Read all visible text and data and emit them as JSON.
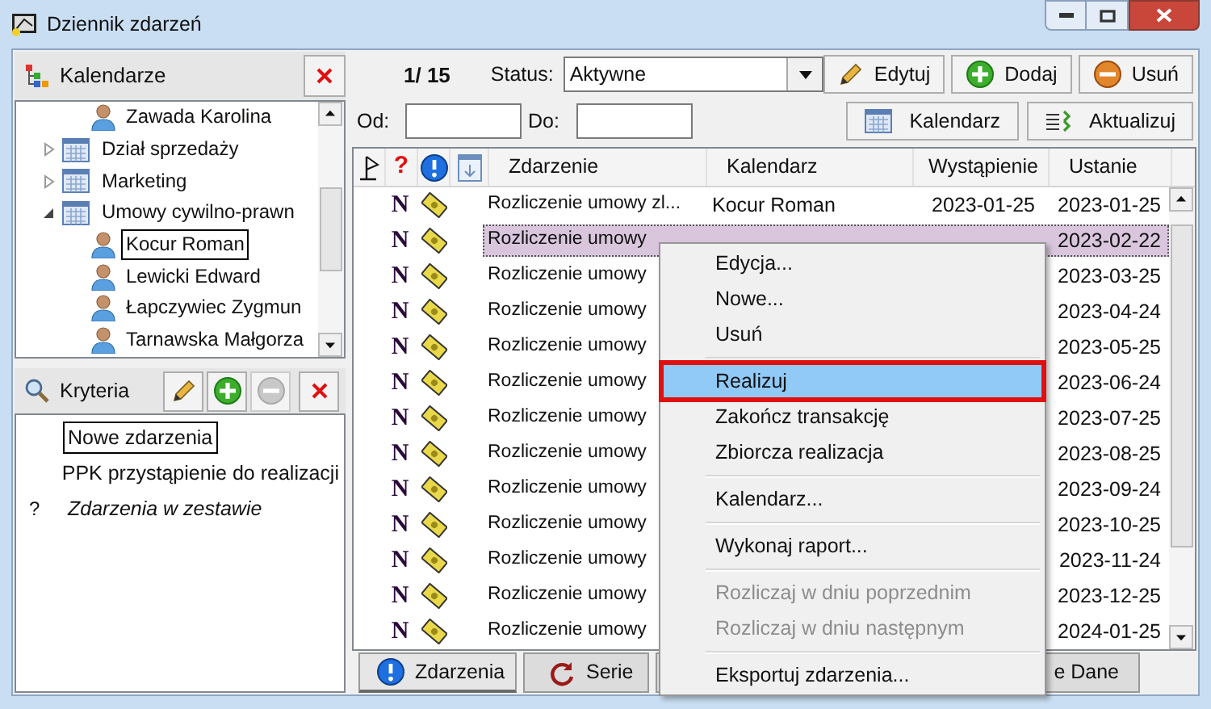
{
  "window": {
    "title": "Dziennik zdarzeń"
  },
  "calendars_panel": {
    "title": "Kalendarze",
    "tree": [
      {
        "label": "Zawada Karolina",
        "kind": "person",
        "focused": false
      },
      {
        "label": "Dział sprzedaży",
        "kind": "group",
        "expanded": false,
        "focused": false
      },
      {
        "label": "Marketing",
        "kind": "group",
        "expanded": false,
        "focused": false
      },
      {
        "label": "Umowy cywilno-prawn",
        "kind": "group",
        "expanded": true,
        "focused": false,
        "children": [
          {
            "label": "Kocur Roman",
            "kind": "person",
            "focused": true
          },
          {
            "label": "Lewicki Edward",
            "kind": "person",
            "focused": false
          },
          {
            "label": "Łapczywiec Zygmun",
            "kind": "person",
            "focused": false
          },
          {
            "label": "Tarnawska Małgorza",
            "kind": "person",
            "focused": false
          }
        ]
      }
    ]
  },
  "criteria_panel": {
    "title": "Kryteria",
    "tools": [
      {
        "kind": "pencil",
        "disabled": false
      },
      {
        "kind": "plus",
        "disabled": false
      },
      {
        "kind": "minus",
        "disabled": true
      }
    ],
    "items": [
      {
        "label": "Nowe zdarzenia",
        "focused": true,
        "italic": false
      },
      {
        "label": "PPK przystąpienie do realizacji",
        "focused": false,
        "italic": false
      },
      {
        "prefix": "?",
        "label": "Zdarzenia w zestawie",
        "focused": false,
        "italic": true
      }
    ]
  },
  "toolbar": {
    "counter": "1/ 15",
    "status_label": "Status:",
    "status_value": "Aktywne",
    "buttons": [
      {
        "label": "Edytuj",
        "kind": "pencil"
      },
      {
        "label": "Dodaj",
        "kind": "plus"
      },
      {
        "label": "Usuń",
        "kind": "minus"
      }
    ],
    "from_label": "Od:",
    "to_label": "Do:",
    "buttons2": [
      {
        "label": "Kalendarz",
        "kind": "calendar"
      },
      {
        "label": "Aktualizuj",
        "kind": "refresh"
      }
    ]
  },
  "table": {
    "icon_columns": [
      {
        "kind": "flag"
      },
      {
        "kind": "text",
        "label": "?"
      },
      {
        "kind": "info"
      },
      {
        "kind": "sort"
      }
    ],
    "columns": [
      "Zdarzenie",
      "Kalendarz",
      "Wystąpienie",
      "Ustanie"
    ],
    "rows": [
      {
        "mark": "N",
        "event": "Rozliczenie umowy zl...",
        "calendar": "Kocur Roman",
        "occurred": "2023-01-25",
        "settled": "2023-01-25",
        "selected": false
      },
      {
        "mark": "N",
        "event": "Rozliczenie umowy",
        "settled": "2023-02-22",
        "selected": true
      },
      {
        "mark": "N",
        "event": "Rozliczenie umowy",
        "settled": "2023-03-25",
        "selected": false
      },
      {
        "mark": "N",
        "event": "Rozliczenie umowy",
        "settled": "2023-04-24",
        "selected": false
      },
      {
        "mark": "N",
        "event": "Rozliczenie umowy",
        "settled": "2023-05-25",
        "selected": false
      },
      {
        "mark": "N",
        "event": "Rozliczenie umowy",
        "settled": "2023-06-24",
        "selected": false
      },
      {
        "mark": "N",
        "event": "Rozliczenie umowy",
        "settled": "2023-07-25",
        "selected": false
      },
      {
        "mark": "N",
        "event": "Rozliczenie umowy",
        "settled": "2023-08-25",
        "selected": false
      },
      {
        "mark": "N",
        "event": "Rozliczenie umowy",
        "settled": "2023-09-24",
        "selected": false
      },
      {
        "mark": "N",
        "event": "Rozliczenie umowy",
        "settled": "2023-10-25",
        "selected": false
      },
      {
        "mark": "N",
        "event": "Rozliczenie umowy",
        "settled": "2023-11-24",
        "selected": false
      },
      {
        "mark": "N",
        "event": "Rozliczenie umowy",
        "settled": "2023-12-25",
        "selected": false
      },
      {
        "mark": "N",
        "event": "Rozliczenie umowy",
        "settled": "2024-01-25",
        "selected": false
      }
    ]
  },
  "tabs": [
    {
      "label": "Zdarzenia",
      "kind": "info",
      "selected": true
    },
    {
      "label": "Serie",
      "kind": "series",
      "selected": false
    },
    {
      "label": "e Dane",
      "kind": "plain",
      "selected": false
    }
  ],
  "context_menu": [
    {
      "kind": "item",
      "label": "Edycja...",
      "selected": false,
      "disabled": false,
      "outlined": false
    },
    {
      "kind": "item",
      "label": "Nowe...",
      "selected": false,
      "disabled": false,
      "outlined": false
    },
    {
      "kind": "item",
      "label": "Usuń",
      "selected": false,
      "disabled": false,
      "outlined": false
    },
    {
      "kind": "separator"
    },
    {
      "kind": "item",
      "label": "Realizuj",
      "selected": true,
      "disabled": false,
      "outlined": true
    },
    {
      "kind": "item",
      "label": "Zakończ transakcję",
      "selected": false,
      "disabled": false,
      "outlined": false
    },
    {
      "kind": "item",
      "label": "Zbiorcza realizacja",
      "selected": false,
      "disabled": false,
      "outlined": false
    },
    {
      "kind": "separator"
    },
    {
      "kind": "item",
      "label": "Kalendarz...",
      "selected": false,
      "disabled": false,
      "outlined": false
    },
    {
      "kind": "separator"
    },
    {
      "kind": "item",
      "label": "Wykonaj raport...",
      "selected": false,
      "disabled": false,
      "outlined": false
    },
    {
      "kind": "separator"
    },
    {
      "kind": "item",
      "label": "Rozliczaj w dniu poprzednim",
      "selected": false,
      "disabled": true,
      "outlined": false
    },
    {
      "kind": "item",
      "label": "Rozliczaj w dniu następnym",
      "selected": false,
      "disabled": true,
      "outlined": false
    },
    {
      "kind": "separator"
    },
    {
      "kind": "item",
      "label": "Eksportuj zdarzenia...",
      "selected": false,
      "disabled": false,
      "outlined": false
    }
  ]
}
